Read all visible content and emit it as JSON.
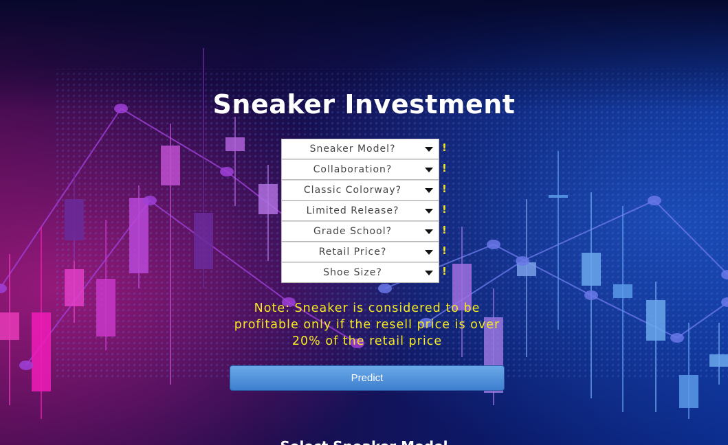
{
  "page": {
    "title": "Sneaker Investment",
    "bottom_text": "Select Sneaker Model"
  },
  "form": {
    "fields": [
      {
        "label": "Sneaker Model?",
        "warning": "!"
      },
      {
        "label": "Collaboration?",
        "warning": "!"
      },
      {
        "label": "Classic Colorway?",
        "warning": "!"
      },
      {
        "label": "Limited Release?",
        "warning": "!"
      },
      {
        "label": "Grade School?",
        "warning": "!"
      },
      {
        "label": "Retail Price?",
        "warning": "!"
      },
      {
        "label": "Shoe Size?",
        "warning": "!"
      }
    ],
    "note": "Note: Sneaker is considered to be profitable only if the resell price is over 20% of the retail price",
    "predict_label": "Predict"
  },
  "icons": {
    "dropdown": "chevron-down-icon",
    "warning": "exclamation-icon"
  },
  "colors": {
    "warning": "#f5e61a",
    "note": "#f6ea22",
    "button": "#4a8ad8",
    "background_left": "#c0208f",
    "background_right": "#1a3aa8"
  }
}
